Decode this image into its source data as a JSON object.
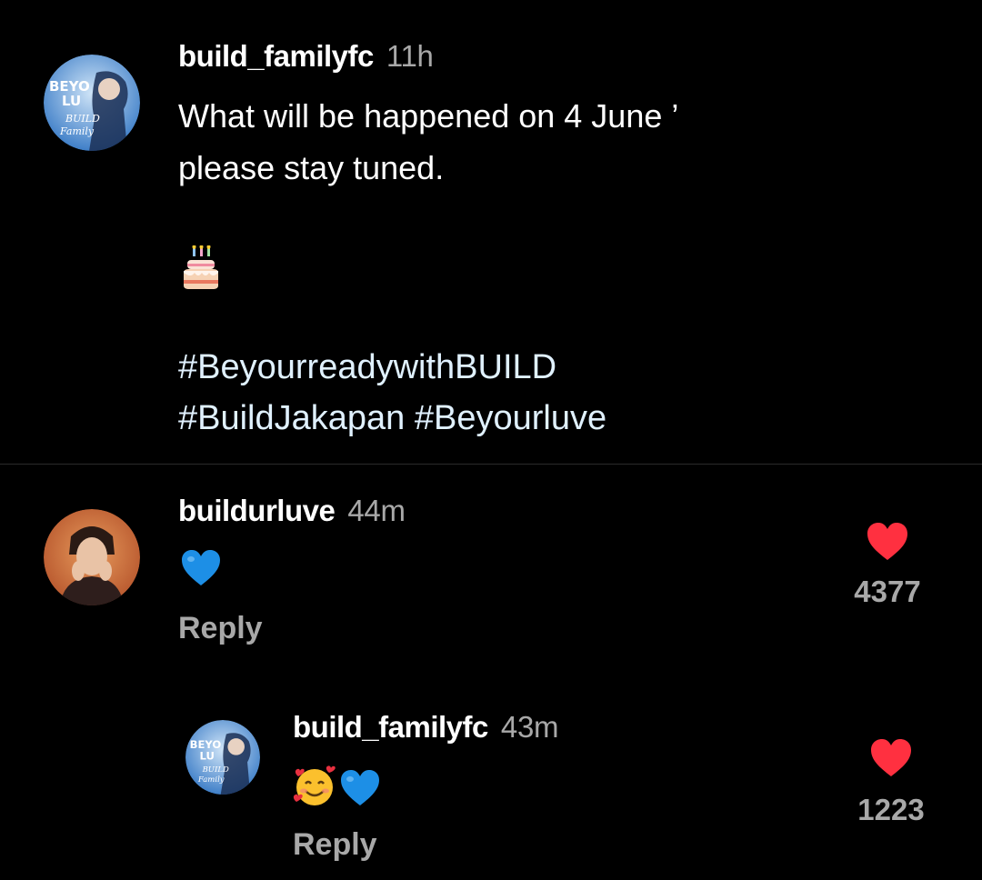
{
  "post": {
    "username": "build_familyfc",
    "time": "11h",
    "caption_line1": "What will be happened on 4 June ’",
    "caption_line2": "please stay tuned.",
    "emoji": "birthday-cake",
    "hashtag_line1": "#BeyourreadywithBUILD",
    "hashtag_line2": "#BuildJakapan #Beyourluve",
    "avatar_text": [
      "BEYO",
      "LU",
      "BUILD",
      "Family"
    ]
  },
  "comments": [
    {
      "username": "buildurluve",
      "time": "44m",
      "emoji": "blue-heart",
      "reply_label": "Reply",
      "like_count": "4377"
    },
    {
      "username": "build_familyfc",
      "time": "43m",
      "emoji": "smiling-face-with-hearts blue-heart",
      "reply_label": "Reply",
      "like_count": "1223",
      "avatar_text": [
        "BEYO",
        "LU",
        "BUILD",
        "Family"
      ]
    }
  ],
  "colors": {
    "background": "#000000",
    "text": "#ffffff",
    "muted": "#a8a8a8",
    "hashtag": "#e0f1ff",
    "like": "#ff3040",
    "blue_heart": "#1d8fe6"
  }
}
